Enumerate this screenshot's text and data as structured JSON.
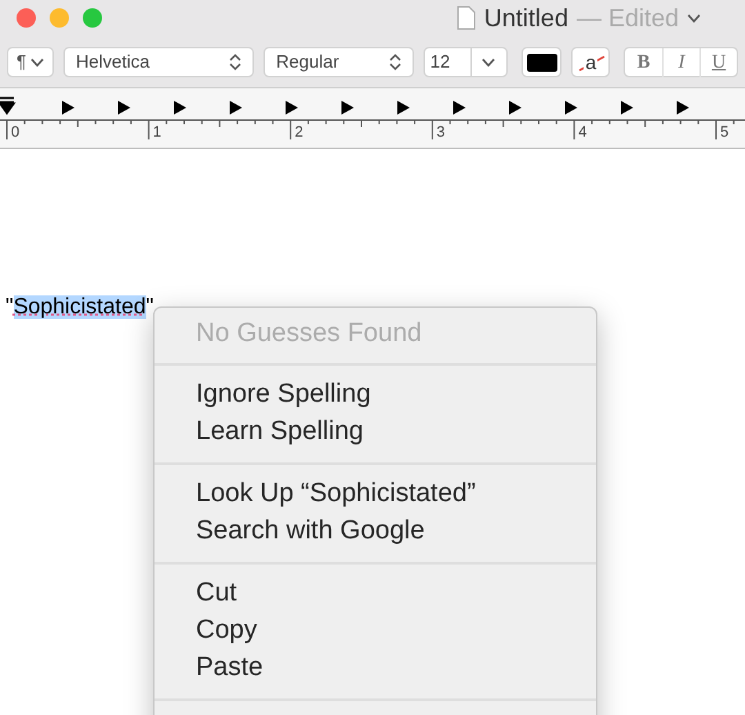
{
  "window": {
    "title": "Untitled",
    "status": "— Edited"
  },
  "toolbar": {
    "paragraph": "¶",
    "font": "Helvetica",
    "style": "Regular",
    "size": "12",
    "bold": "B",
    "italic": "I",
    "underline": "U",
    "highlight": "a"
  },
  "ruler": {
    "numbers": [
      "0",
      "1",
      "2",
      "3",
      "4",
      "5"
    ]
  },
  "document": {
    "before": "\"",
    "selected_text": "Sophicistated",
    "after": "\""
  },
  "context_menu": {
    "groups": [
      [
        {
          "label": "No Guesses Found",
          "disabled": true
        }
      ],
      [
        {
          "label": "Ignore Spelling",
          "disabled": false
        },
        {
          "label": "Learn Spelling",
          "disabled": false
        }
      ],
      [
        {
          "label": "Look Up “Sophicistated”",
          "disabled": false
        },
        {
          "label": "Search with Google",
          "disabled": false
        }
      ],
      [
        {
          "label": "Cut",
          "disabled": false
        },
        {
          "label": "Copy",
          "disabled": false
        },
        {
          "label": "Paste",
          "disabled": false
        }
      ]
    ]
  }
}
